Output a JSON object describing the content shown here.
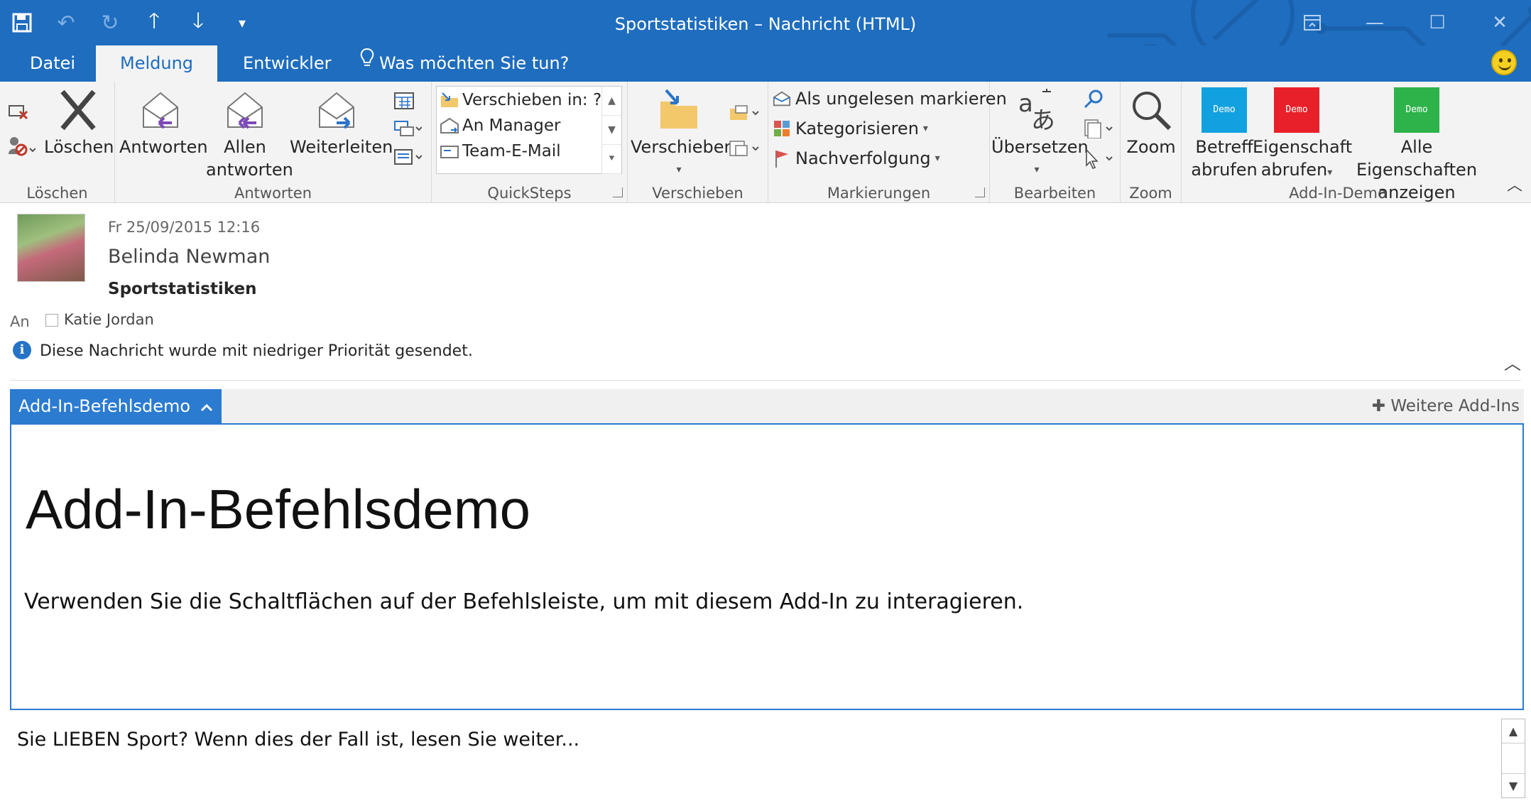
{
  "window": {
    "title": "Sportstatistiken – Nachricht (HTML)",
    "accent": "#1e6dbf"
  },
  "qat": {
    "save_icon": "save-icon",
    "undo_icon": "undo-icon",
    "redo_icon": "redo-icon",
    "up_icon": "arrow-up-icon",
    "down_icon": "arrow-down-icon",
    "customize_icon": "qat-customize-icon"
  },
  "tabs": [
    {
      "label": "Datei"
    },
    {
      "label": "Meldung"
    },
    {
      "label": "Entwickler"
    }
  ],
  "tellme": "Was möchten Sie tun?",
  "ribbon": {
    "loeschen": {
      "group_label": "Löschen",
      "delete_label": "Löschen"
    },
    "antworten": {
      "group_label": "Antworten",
      "reply": "Antworten",
      "reply_all_1": "Allen",
      "reply_all_2": "antworten",
      "forward": "Weiterleiten"
    },
    "quicksteps": {
      "group_label": "QuickSteps",
      "items": [
        "Verschieben in: ?",
        "An Manager",
        "Team-E-Mail"
      ]
    },
    "verschieben": {
      "group_label": "Verschieben",
      "move": "Verschieben"
    },
    "markierungen": {
      "group_label": "Markierungen",
      "unread": "Als ungelesen markieren",
      "categorize": "Kategorisieren",
      "followup": "Nachverfolgung"
    },
    "bearbeiten": {
      "group_label": "Bearbeiten",
      "translate": "Übersetzen"
    },
    "zoom": {
      "group_label": "Zoom",
      "zoom": "Zoom"
    },
    "addin_demo": {
      "group_label": "Add-In-Demo",
      "tile_text": "Demo",
      "btn1_l1": "Betreff",
      "btn1_l2": "abrufen",
      "btn2_l1": "Eigenschaft",
      "btn2_l2": "abrufen",
      "btn3_l1": "Alle Eigenschaften",
      "btn3_l2": "anzeigen",
      "colors": [
        "#12a1e0",
        "#e8202a",
        "#2db34a"
      ]
    }
  },
  "message": {
    "date": "Fr 25/09/2015 12:16",
    "sender": "Belinda Newman",
    "subject": "Sportstatistiken",
    "to_label": "An",
    "to_name": "Katie Jordan",
    "info": "Diese Nachricht wurde mit niedriger Priorität gesendet."
  },
  "addin": {
    "tab_label": "Add-In-Befehlsdemo",
    "more": "Weitere Add-Ins",
    "pane_title": "Add-In-Befehlsdemo",
    "pane_text": "Verwenden Sie die Schaltflächen auf der Befehlsleiste, um mit diesem Add-In zu interagieren."
  },
  "body": {
    "text": "Sie LIEBEN Sport? Wenn dies der Fall ist, lesen Sie weiter..."
  }
}
